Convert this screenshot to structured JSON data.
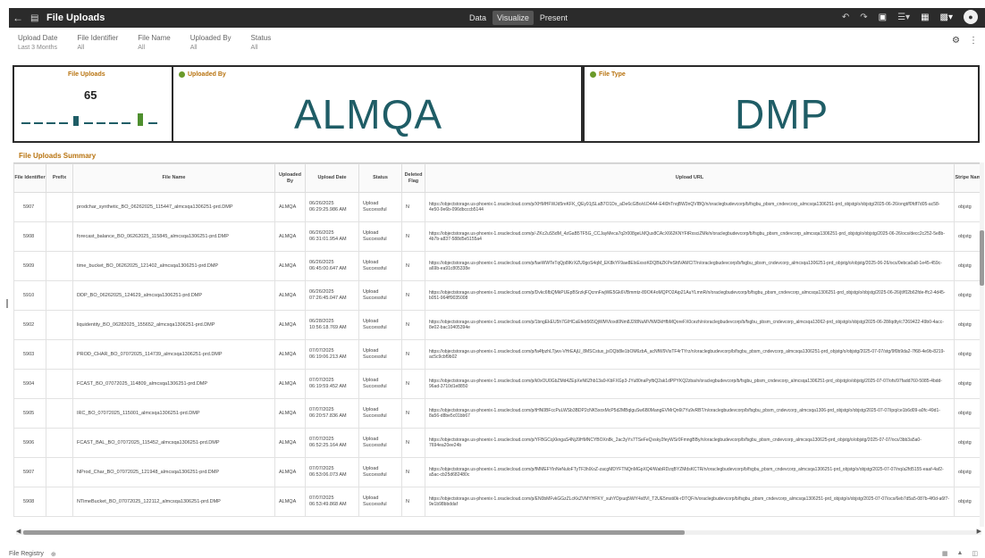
{
  "topbar": {
    "back_label": "←",
    "title": "File Uploads",
    "modes": [
      "Data",
      "Visualize",
      "Present"
    ],
    "active_mode": "Visualize"
  },
  "filters": [
    {
      "label": "Upload Date",
      "value": "Last 3 Months"
    },
    {
      "label": "File Identifier",
      "value": "All"
    },
    {
      "label": "File Name",
      "value": "All"
    },
    {
      "label": "Uploaded By",
      "value": "All"
    },
    {
      "label": "Status",
      "value": "All"
    }
  ],
  "kpi": {
    "file_uploads": {
      "title": "File Uploads",
      "count": "65"
    },
    "uploaded_by": {
      "title": "Uploaded By",
      "value": "ALMQA"
    },
    "file_type": {
      "title": "File Type",
      "value": "DMP"
    }
  },
  "spark_bars": [
    {
      "level": 0.55,
      "color": "#1f5d66"
    },
    {
      "level": 0.7,
      "color": "#4e8f2e"
    }
  ],
  "summary": {
    "title": "File Uploads Summary",
    "columns": [
      "File Identifier",
      "Prefix",
      "File Name",
      "Uploaded By",
      "Upload Date",
      "Status",
      "Deleted Flag",
      "Upload URL",
      "Stripe Name"
    ],
    "rows": [
      {
        "id": "5907",
        "prefix": "",
        "name": "prodchar_synthetic_BO_06262025_115447_almcsqa1306251-prd.DMP",
        "by": "ALMQA",
        "date": "06/26/2025 06:29:25.986 AM",
        "status": "Upload Successful",
        "flag": "N",
        "url": "https://objectstorage.us-phoenix-1.oraclecloud.com/p/XHMHFWJd5reKFK_QEy91jSLaB7O1Dx_aDe6cGBo/d.D4A4-E4l0hTnqBW3nQVIBQ/n/oraclegbudevcorp/b/fsgbu_pbsm_cndevcorp_almcsqa1306251-prd_objstg/o/objstg/2025-06-26/ongt/f0fdf7d05-ac58-4e50-9e6b-096dbcccb5144",
        "stripe": "objstg"
      },
      {
        "id": "5908",
        "prefix": "",
        "name": "forecast_balance_BO_06262025_115845_almcsqa1306251-prd.DMP",
        "by": "ALMQA",
        "date": "06/26/2025 06:31:01.954 AM",
        "status": "Upload Successful",
        "flag": "N",
        "url": "https://objectstorage.us-phoenix-1.oraclecloud.com/p/-ZKc2uS5dM_4zGaB5TF5G_CCJayMeca7q2r008geLMQux8CAcX662KNYFtRxsciZMk/n/oraclegbudevcorp/b/fsgbu_pbsm_cndevcorp_almcsqa1306251-prd_objstg/o/objstg/2025-06-26/ocs/decc2c252-5e8b-4b7b-a837-588d5e5155a4",
        "stripe": "objstg"
      },
      {
        "id": "5909",
        "prefix": "",
        "name": "time_bucket_BO_06262025_121402_almcsqa1306251-prd.DMP",
        "by": "ALMQA",
        "date": "06/26/2025 06:45:00.647 AM",
        "status": "Upload Successful",
        "flag": "N",
        "url": "https://objectstorage.us-phoenix-1.oraclecloud.com/p/faeWWTeTqQp8lKrXZU0goS4qM_EK8kYF9ae8ElxExsoKDQBkZKPeSfdVAMCIT/n/oraclegbudevcorp/b/fsgbu_pbsm_cndevcorp_almcsqa1306251-prd_objstg/o/objstg/2025-06-26/ocs/0ebca0a8-1e45-459c-a69b-ea91c805338e",
        "stripe": "objstg"
      },
      {
        "id": "5910",
        "prefix": "",
        "name": "DDP_BO_06262025_124629_almcsqa1306251-prd.DMP",
        "by": "ALMQA",
        "date": "06/26/2025 07:26:45.047 AM",
        "status": "Upload Successful",
        "flag": "N",
        "url": "https://objectstorage.us-phoenix-1.oraclecloud.com/p/Dvkc6fbQMkPUEpBSrzkjFQcnnFwjWE5Gk6VBmmtz-89OK4oMQPO2Aip21AuYLmnR/n/oraclegbudevcorp/b/fsgbu_pbsm_cndevcorp_almcsqa1306251-prd_objstg/o/objstg/2025-06-26/jt/f02b62fde-ffc2-4d45-b051-964ff9035008",
        "stripe": "objstg"
      },
      {
        "id": "5902",
        "prefix": "",
        "name": "liquidentity_BO_06282025_155652_almcsqa1306251-prd.DMP",
        "by": "ALMQA",
        "date": "06/28/2025 10:56:18.769 AM",
        "status": "Upload Successful",
        "flag": "N",
        "url": "https://objectstorage.us-phoenix-1.oraclecloud.com/p/1bngEkEU5h7GIHCaEfeb565QjWMVloxd0Nm8J2I8NuMVNM3kHfbMQoreFX0cezh/n/oraclegbudevcorp/b/fsgbu_pbsm_cndevcorp_almcsqa13062-prd_objstg/o/objstg/2025-06-28/lqdty/c7269422-49b0-4acc-8e02-bac10405394e",
        "stripe": "objstg"
      },
      {
        "id": "5903",
        "prefix": "",
        "name": "PROD_CHAR_BO_07072025_114739_almcsqa1306251-prd.DMP",
        "by": "ALMQA",
        "date": "07/07/2025 06:19:06.213 AM",
        "status": "Upload Successful",
        "flag": "N",
        "url": "https://objectstorage.us-phoenix-1.oraclecloud.com/p/fa4fpzhLTjwx-VHrEAjU_8MSCstux_jsOQb8le1bOM6zbA_acNfW9VisTF4rTYrz/n/oraclegbudevcorp/b/fsgbu_pbsm_cndevcorp_almcsqa1306251-prd_objstg/o/objstg/2025-07-07/stg/9f0b9da2-7f68-4e9b-8219-ac5c9cbf9b02",
        "stripe": "objstg"
      },
      {
        "id": "5904",
        "prefix": "",
        "name": "FCAST_BO_07072025_114809_almcsqa1306251-prd.DMP",
        "by": "ALMQA",
        "date": "07/07/2025 06:19:59.452 AM",
        "status": "Upload Successful",
        "flag": "N",
        "url": "https://objectstorage.us-phoenix-1.oraclecloud.com/p/k0xOU0GbZMd4ZEpXeN6Zhb13a9-KbFXGp3-JYu80naPyfbQ2ak1dPPYKQ2zba/n/oraclegbudevcorp/b/fsgbu_pbsm_cndevcorp_almcsqa1306251-prd_objstg/o/objstg/2025-07-07/ofs/97fadd760-5085-4bdd-96ad-3710d1e8850",
        "stripe": "objstg"
      },
      {
        "id": "5905",
        "prefix": "",
        "name": "IRC_BO_07072025_115001_almcsqa1306251-prd.DMP",
        "by": "ALMQA",
        "date": "07/07/2025 06:20:57.836 AM",
        "status": "Upload Successful",
        "flag": "N",
        "url": "https://objectstorage.us-phoenix-1.oraclecloud.com/p/tHN0BFccPuLWSb3BDP2cNK5xoxMcP5d2MBqlguSw6B0MangEVMrQn6t7Yu9vRBT/n/oraclegbudevcorp/b/fsgbu_pbsm_cndevcorp_almcsqa1306-prd_objstg/o/objstg/2025-07-07/ipq/ce1b6d09-a0fc-49d1-8a56-d8be5c01bb67",
        "stripe": "objstg"
      },
      {
        "id": "5906",
        "prefix": "",
        "name": "FCAST_BAL_BO_07072025_115452_almcsqa1306251-prd.DMP",
        "by": "ALMQA",
        "date": "07/07/2025 06:52:25.164 AM",
        "status": "Upload Successful",
        "flag": "N",
        "url": "https://objectstorage.us-phoenix-1.oraclecloud.com/p/YFBGCqXkngaS4NjJ9HMNCYBOXn8k_2ac3yYs7TSeFeQvsky2feyWSr0FmngBBy/n/oraclegbudevcorp/b/fsgbu_pbsm_cndevcorp_almcsqa130625-prd_objstg/o/objstg/2025-07-07/ocs/3bb3a5a0-7694ea20ee24b",
        "stripe": "objstg"
      },
      {
        "id": "5907",
        "prefix": "",
        "name": "NProd_Char_BO_07072025_121948_almcsqa1306251-prd.DMP",
        "by": "ALMQA",
        "date": "07/07/2025 06:53:06.073 AM",
        "status": "Upload Successful",
        "flag": "N",
        "url": "https://objectstorage.us-phoenix-1.oraclecloud.com/p/fMMEFYlnNeNuloFTyTF3hlXoZ-zacgMDYFTNQnMGpXQ4/WabRDzqBYZMdsKCTR/n/oraclegbudevcorp/b/fsgbu_pbsm_cndevcorp_almcsqa1306251-prd_objstg/o/objstg/2025-07-07/nq/a2fd5155-eaaf-4af2-a5ac-cb25d682480c",
        "stripe": "objstg"
      },
      {
        "id": "5908",
        "prefix": "",
        "name": "NTimeBucket_BO_07072025_122112_almcsqa1306251-prd.DMP",
        "by": "ALMQA",
        "date": "07/07/2025 06:53:49.868 AM",
        "status": "Upload Successful",
        "flag": "N",
        "url": "https://objectstorage.us-phoenix-1.oraclecloud.com/p/EN0bMFvkGGzZLcKkZVMYHFKY_xuhYDjxuq5WiY4x8Vl_T2UE5msti0k-rDTQF/n/oraclegbudevcorp/b/fsgbu_pbsm_cndevcorp_almcsqa1306251-prd_objstg/o/objstg/2025-07-07/ocs/6eb7d5a5-087b-4f0d-a6f7-9e1b98bbddaf",
        "stripe": "objstg"
      }
    ]
  },
  "footer": {
    "tab_label": "File Registry"
  }
}
